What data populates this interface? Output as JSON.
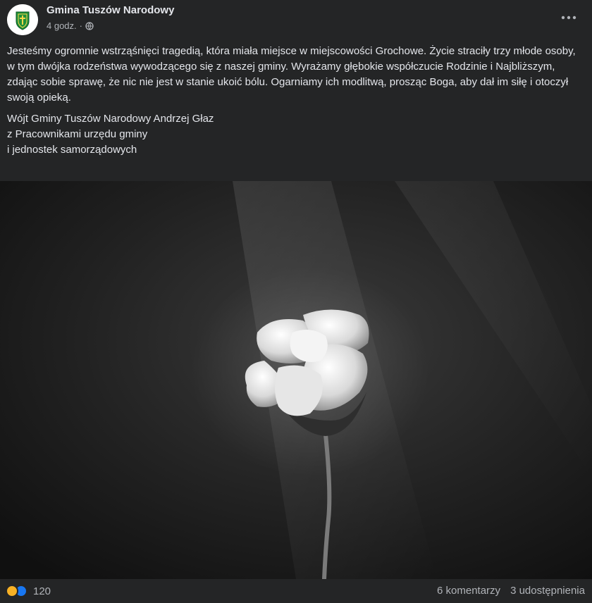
{
  "page": {
    "name": "Gmina Tuszów Narodowy",
    "time": "4 godz.",
    "separator": "·"
  },
  "post": {
    "paragraph": "Jesteśmy ogromnie wstrząśnięci tragedią, która miała miejsce w miejscowości Grochowe. Życie straciły trzy młode osoby, w tym dwójka rodzeństwa wywodzącego się z naszej gminy. Wyrażamy głębokie współczucie Rodzinie i Najbliższym, zdając sobie sprawę, że nic nie jest w stanie ukoić bólu. Ogarniamy ich modlitwą, prosząc Boga, aby dał im siłę i otoczył swoją opieką.",
    "signature": [
      "Wójt Gminy Tuszów Narodowy Andrzej Głaz",
      "z Pracownikami urzędu gminy",
      "i jednostek samorządowych"
    ]
  },
  "footer": {
    "reaction_count": "120",
    "comments": "6 komentarzy",
    "shares": "3 udostępnienia"
  },
  "icons": {
    "avatar": "coat-of-arms-icon",
    "privacy": "globe-icon",
    "more": "more-options-icon",
    "reaction_1": "sad-reaction-icon",
    "reaction_2": "like-reaction-icon"
  },
  "colors": {
    "background": "#242526",
    "text": "#e4e6eb",
    "secondary_text": "#b0b3b8",
    "crest_green": "#1f8f3a",
    "like_blue": "#1877f2",
    "sad_yellow": "#f7b125"
  }
}
